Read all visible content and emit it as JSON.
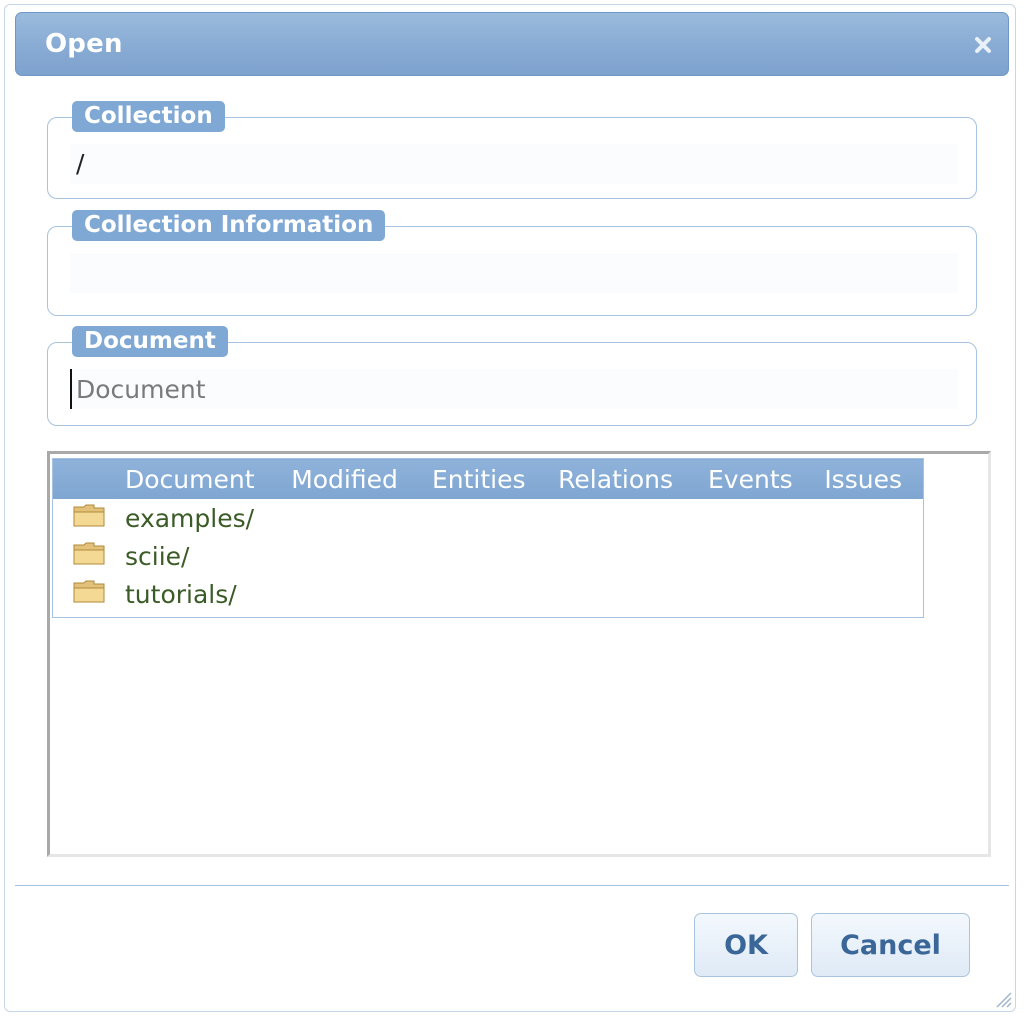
{
  "dialog": {
    "title": "Open",
    "close_icon": "close-icon"
  },
  "collection": {
    "legend": "Collection",
    "value": "/"
  },
  "collection_info": {
    "legend": "Collection Information",
    "value": ""
  },
  "document": {
    "legend": "Document",
    "value": "",
    "placeholder": "Document"
  },
  "table": {
    "headers": [
      "Document",
      "Modified",
      "Entities",
      "Relations",
      "Events",
      "Issues"
    ],
    "rows": [
      {
        "icon": "folder-icon",
        "name": "examples/"
      },
      {
        "icon": "folder-icon",
        "name": "sciie/"
      },
      {
        "icon": "folder-icon",
        "name": "tutorials/"
      }
    ]
  },
  "buttons": {
    "ok": "OK",
    "cancel": "Cancel"
  },
  "colors": {
    "titlebar": "#88abd4",
    "legend_tag": "#80a8d4",
    "border": "#a6c3e2",
    "row_text": "#3b5b27",
    "button_text": "#3b6698"
  }
}
